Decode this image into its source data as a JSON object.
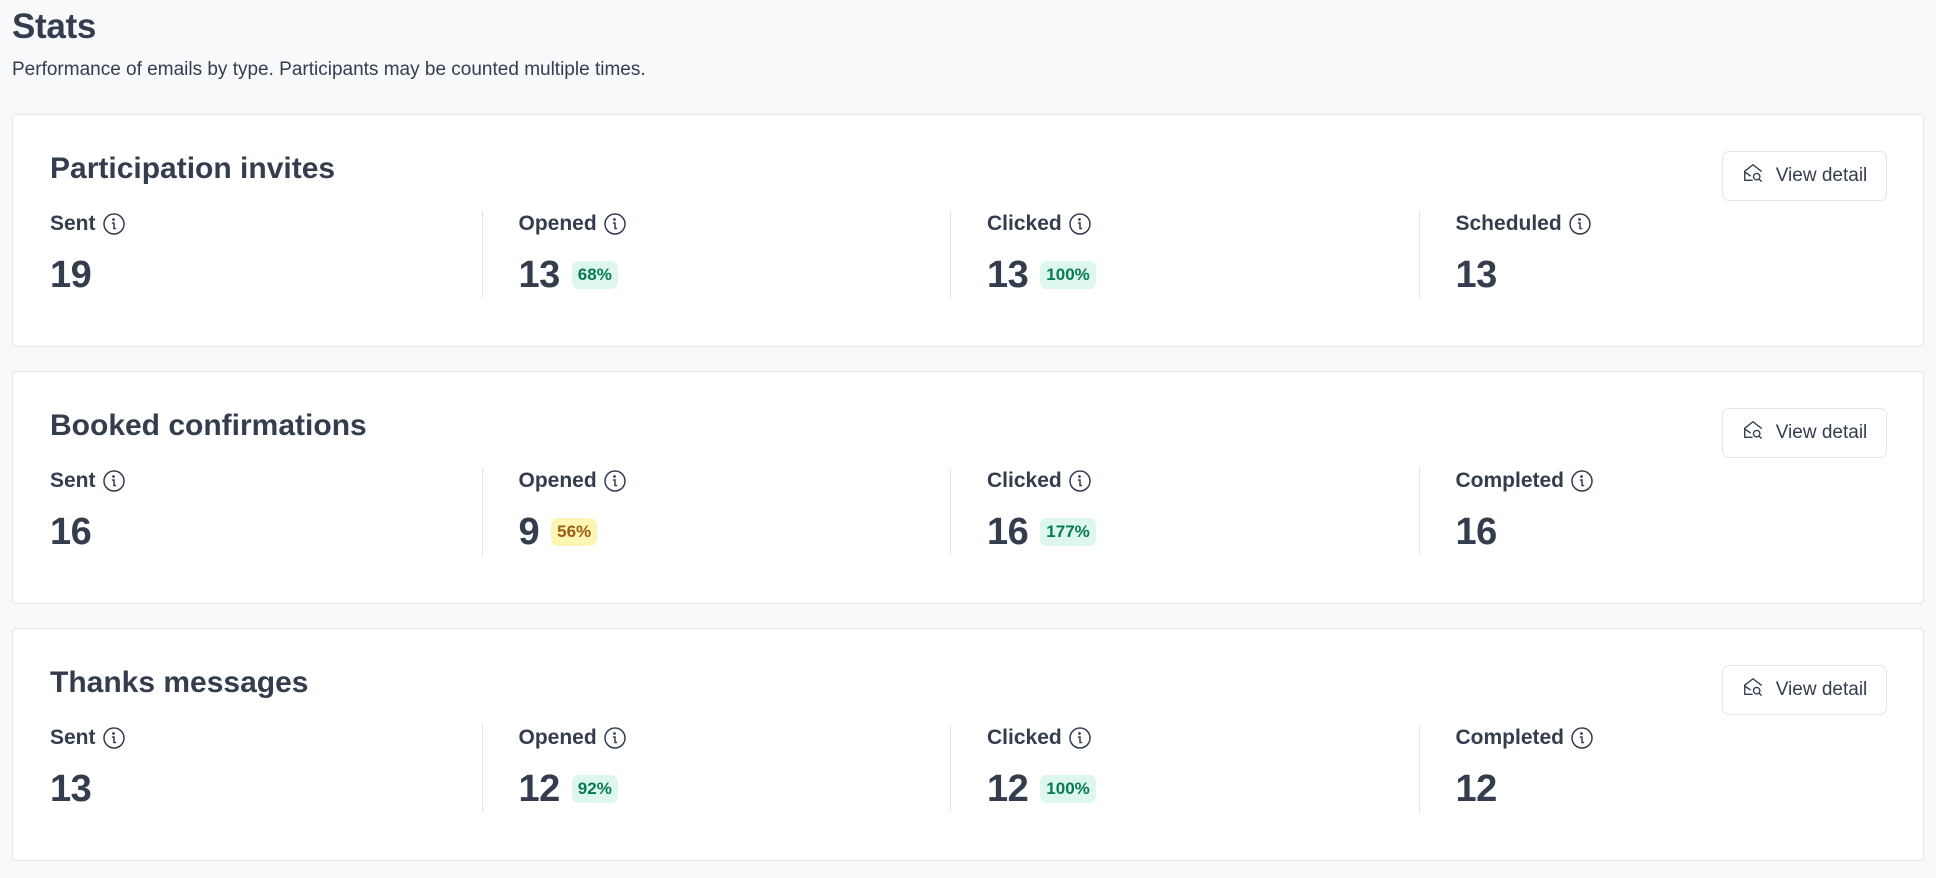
{
  "header": {
    "title": "Stats",
    "subtitle": "Performance of emails by type. Participants may be counted multiple times."
  },
  "colors": {
    "badge_good_bg": "#def7ec",
    "badge_good_text": "#057a55",
    "badge_warn_bg": "#fdf6b2",
    "badge_warn_text": "#9a5b13"
  },
  "cards": [
    {
      "title": "Participation invites",
      "button_label": "View detail",
      "button_icon": "envelope-search-icon",
      "metrics": [
        {
          "label": "Sent",
          "value": "19",
          "badge": null
        },
        {
          "label": "Opened",
          "value": "13",
          "badge": {
            "text": "68%",
            "tone": "green"
          }
        },
        {
          "label": "Clicked",
          "value": "13",
          "badge": {
            "text": "100%",
            "tone": "green"
          }
        },
        {
          "label": "Scheduled",
          "value": "13",
          "badge": null
        }
      ]
    },
    {
      "title": "Booked confirmations",
      "button_label": "View detail",
      "button_icon": "envelope-search-icon",
      "metrics": [
        {
          "label": "Sent",
          "value": "16",
          "badge": null
        },
        {
          "label": "Opened",
          "value": "9",
          "badge": {
            "text": "56%",
            "tone": "yellow"
          }
        },
        {
          "label": "Clicked",
          "value": "16",
          "badge": {
            "text": "177%",
            "tone": "green"
          }
        },
        {
          "label": "Completed",
          "value": "16",
          "badge": null
        }
      ]
    },
    {
      "title": "Thanks messages",
      "button_label": "View detail",
      "button_icon": "envelope-search-icon",
      "metrics": [
        {
          "label": "Sent",
          "value": "13",
          "badge": null
        },
        {
          "label": "Opened",
          "value": "12",
          "badge": {
            "text": "92%",
            "tone": "green"
          }
        },
        {
          "label": "Clicked",
          "value": "12",
          "badge": {
            "text": "100%",
            "tone": "green"
          }
        },
        {
          "label": "Completed",
          "value": "12",
          "badge": null
        }
      ]
    }
  ]
}
